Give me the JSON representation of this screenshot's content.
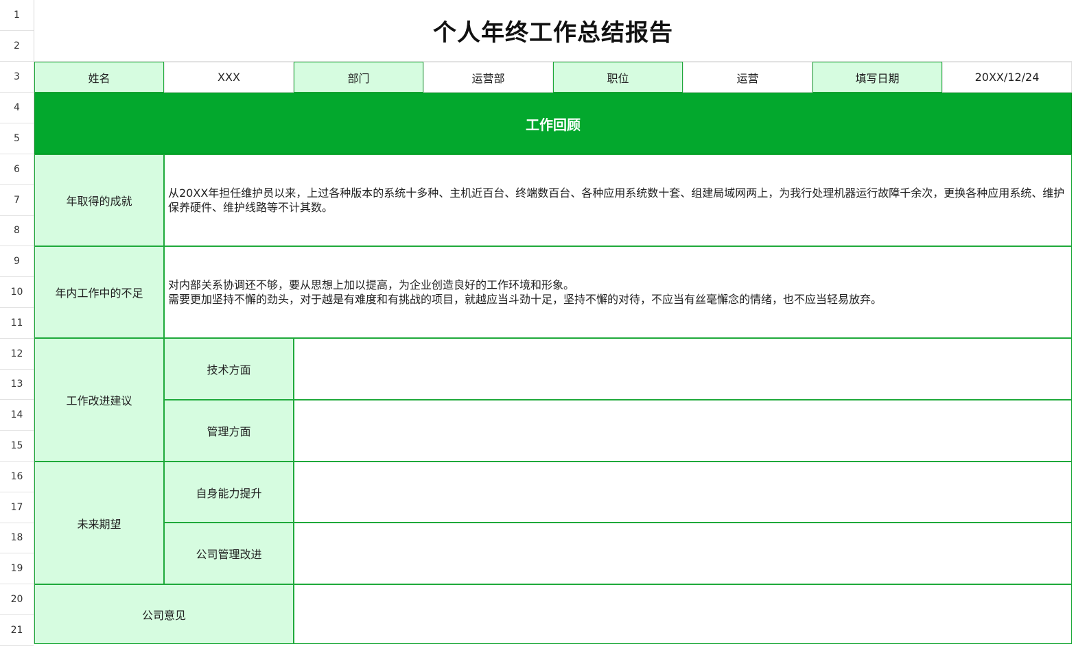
{
  "row_numbers": [
    "1",
    "2",
    "3",
    "4",
    "5",
    "6",
    "7",
    "8",
    "9",
    "10",
    "11",
    "12",
    "13",
    "14",
    "15",
    "16",
    "17",
    "18",
    "19",
    "20",
    "21"
  ],
  "title": "个人年终工作总结报告",
  "info": {
    "name_label": "姓名",
    "name_value": "XXX",
    "dept_label": "部门",
    "dept_value": "运营部",
    "position_label": "职位",
    "position_value": "运营",
    "date_label": "填写日期",
    "date_value": "20XX/12/24"
  },
  "banner": "工作回顾",
  "sections": {
    "achievements": {
      "label": "年取得的成就",
      "text": "从20XX年担任维护员以来，上过各种版本的系统十多种、主机近百台、终端数百台、各种应用系统数十套、组建局域网两上，为我行处理机器运行故障千余次，更换各种应用系统、维护保养硬件、维护线路等不计其数。"
    },
    "shortcomings": {
      "label": "年内工作中的不足",
      "line1": "对内部关系协调还不够，要从思想上加以提高，为企业创造良好的工作环境和形象。",
      "line2": "需要更加坚持不懈的劲头，对于越是有难度和有挑战的项目，就越应当斗劲十足，坚持不懈的对待，不应当有丝毫懈念的情绪，也不应当轻易放弃。"
    },
    "improvement": {
      "label": "工作改进建议",
      "tech": "技术方面",
      "mgmt": "管理方面"
    },
    "future": {
      "label": "未来期望",
      "self": "自身能力提升",
      "company": "公司管理改进"
    },
    "opinion": {
      "label": "公司意见"
    }
  },
  "colors": {
    "label_bg": "#d6fce0",
    "banner_bg": "#03a82d",
    "border": "#1ea93a"
  }
}
